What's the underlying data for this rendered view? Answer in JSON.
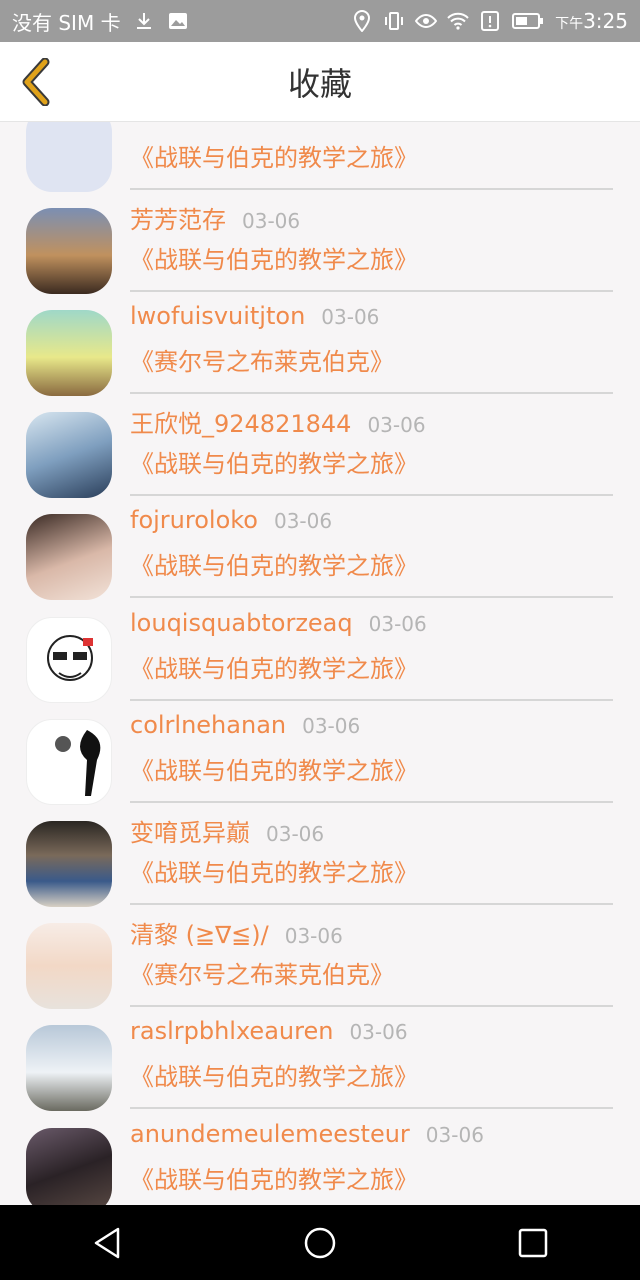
{
  "status_bar": {
    "carrier": "没有 SIM 卡",
    "time_prefix": "下午",
    "time": "3:25"
  },
  "header": {
    "title": "收藏",
    "back_icon": "chevron-left-icon"
  },
  "items": [
    {
      "name": "",
      "date": "",
      "course": "《战联与伯克的教学之旅》",
      "avatar_color": "#dfe4f2"
    },
    {
      "name": "芳芳范存",
      "date": "03-06",
      "course": "《战联与伯克的教学之旅》",
      "avatar_color": "#6b4d3a"
    },
    {
      "name": "lwofuisvuitjton",
      "date": "03-06",
      "course": "《赛尔号之布莱克伯克》",
      "avatar_color": "#b8c46a"
    },
    {
      "name": "王欣悦_924821844",
      "date": "03-06",
      "course": "《战联与伯克的教学之旅》",
      "avatar_color": "#8fb2cc"
    },
    {
      "name": "fojruroloko",
      "date": "03-06",
      "course": "《战联与伯克的教学之旅》",
      "avatar_color": "#8a6a60"
    },
    {
      "name": "louqisquabtorzeaq",
      "date": "03-06",
      "course": "《战联与伯克的教学之旅》",
      "avatar_color": "#f2f2f2"
    },
    {
      "name": "colrlnehanan",
      "date": "03-06",
      "course": "《战联与伯克的教学之旅》",
      "avatar_color": "#e8e8e8"
    },
    {
      "name": "变唷觅异巅",
      "date": "03-06",
      "course": "《战联与伯克的教学之旅》",
      "avatar_color": "#5a5048"
    },
    {
      "name": "清黎 (≧∇≦)/",
      "date": "03-06",
      "course": "《赛尔号之布莱克伯克》",
      "avatar_color": "#f4e6e0"
    },
    {
      "name": "raslrpbhlxeauren",
      "date": "03-06",
      "course": "《战联与伯克的教学之旅》",
      "avatar_color": "#9fb0c0"
    },
    {
      "name": "anundemeulemeesteur",
      "date": "03-06",
      "course": "《战联与伯克的教学之旅》",
      "avatar_color": "#3a2e2c"
    }
  ],
  "colors": {
    "accent": "#f08a4b",
    "date": "#b5b5b5",
    "back_icon": "#e0a21a"
  },
  "nav": {
    "back_icon": "triangle-back-icon",
    "home_icon": "circle-home-icon",
    "recents_icon": "square-recents-icon"
  }
}
